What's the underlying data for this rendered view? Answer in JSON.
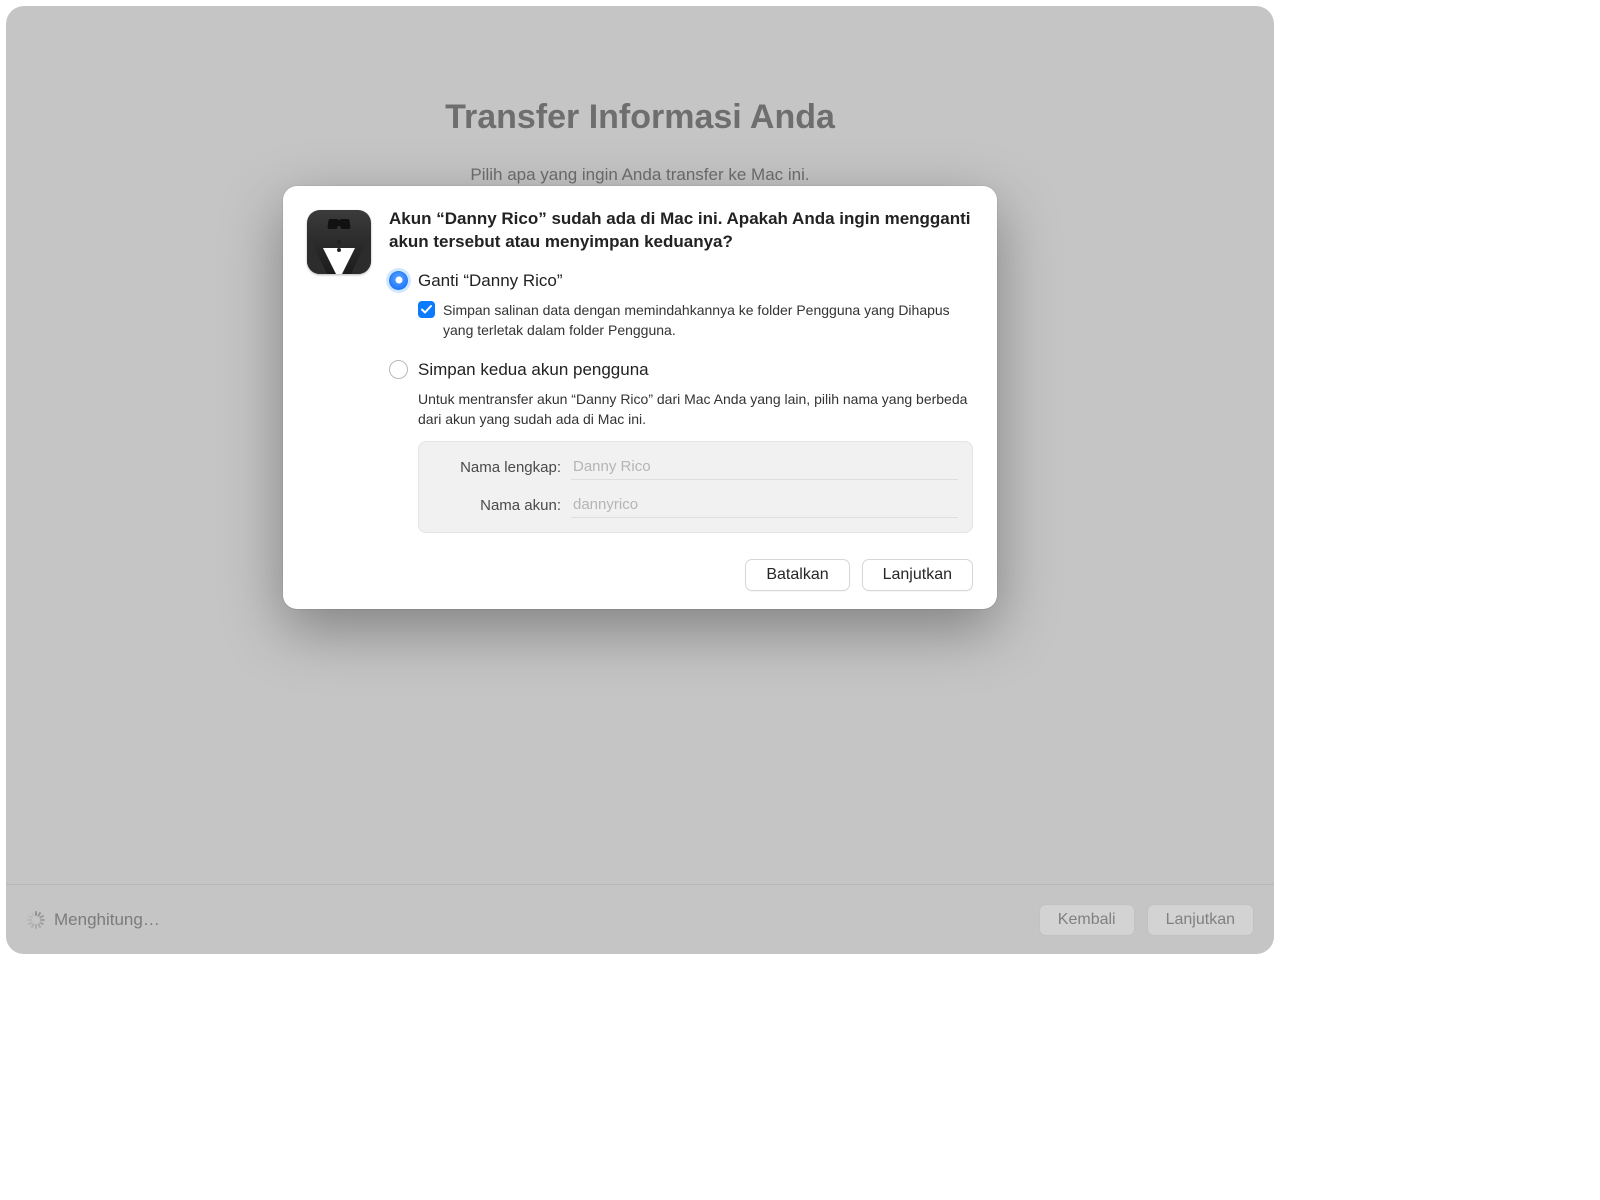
{
  "page": {
    "title": "Transfer Informasi Anda",
    "subtitle": "Pilih apa yang ingin Anda transfer ke Mac ini."
  },
  "modal": {
    "icon": "tuxedo-icon",
    "heading": "Akun “Danny Rico” sudah ada di Mac ini. Apakah Anda ingin mengganti akun tersebut atau menyimpan keduanya?",
    "options": {
      "replace": {
        "label": "Ganti “Danny Rico”",
        "selected": true,
        "save_copy": {
          "checked": true,
          "label": "Simpan salinan data dengan memindahkannya ke folder Pengguna yang Dihapus yang terletak dalam folder Pengguna."
        }
      },
      "keep_both": {
        "label": "Simpan kedua akun pengguna",
        "selected": false,
        "description": "Untuk mentransfer akun “Danny Rico” dari Mac Anda yang lain, pilih nama yang berbeda dari akun yang sudah ada di Mac ini.",
        "fields": {
          "full_name_label": "Nama lengkap:",
          "full_name_value": "Danny Rico",
          "account_name_label": "Nama akun:",
          "account_name_value": "dannyrico"
        }
      }
    },
    "buttons": {
      "cancel": "Batalkan",
      "continue": "Lanjutkan"
    }
  },
  "footer": {
    "status": "Menghitung…",
    "back": "Kembali",
    "continue": "Lanjutkan"
  }
}
